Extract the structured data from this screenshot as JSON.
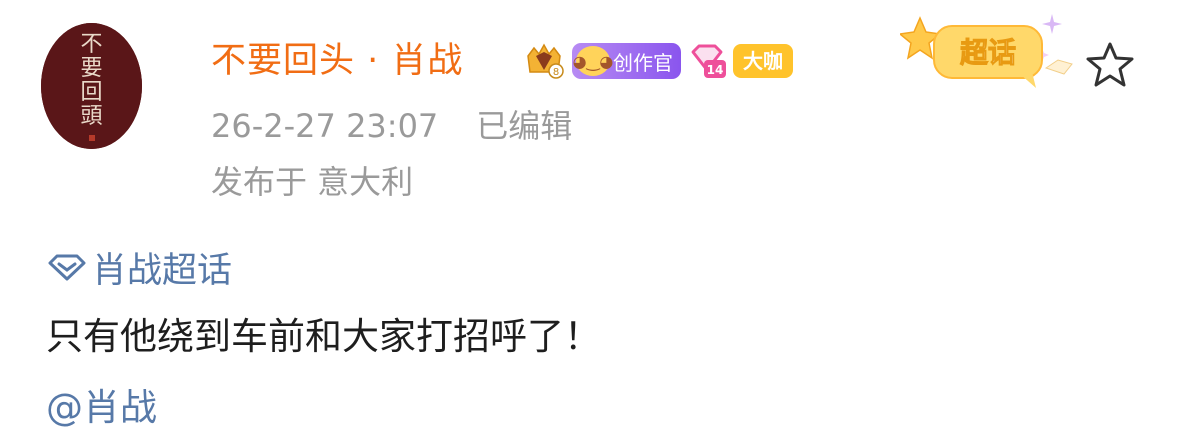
{
  "post": {
    "author": {
      "avatar_text": [
        "不",
        "要",
        "回",
        "頭"
      ],
      "name": "不要回头 · 肖战",
      "badges": {
        "crown_level": "8",
        "creator": "创作官",
        "level": "14",
        "daka": "大咖"
      }
    },
    "timestamp": "26-2-27 23:07",
    "edited": "已编辑",
    "location": "发布于 意大利",
    "sticker_label": "超话",
    "topic": "肖战超话",
    "text": "只有他绕到车前和大家打招呼了！",
    "mention": "@肖战"
  },
  "colors": {
    "username": "#f16d14",
    "meta": "#9a9a9a",
    "link": "#5779a8",
    "avatar_bg": "#5a1618",
    "sticker": "#ffc32b"
  },
  "icons": {
    "supertopic": "diamond-icon",
    "favorite": "star-icon"
  }
}
